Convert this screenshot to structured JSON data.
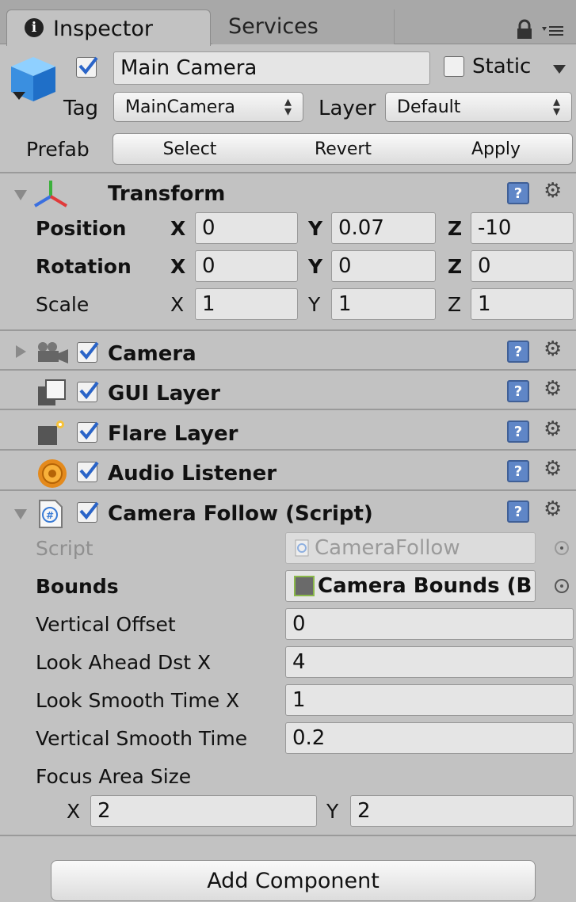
{
  "tabs": {
    "inspector": "Inspector",
    "services": "Services"
  },
  "header": {
    "active": true,
    "name": "Main Camera",
    "static_label": "Static",
    "static_checked": false,
    "tag_label": "Tag",
    "tag_value": "MainCamera",
    "layer_label": "Layer",
    "layer_value": "Default",
    "prefab_label": "Prefab",
    "prefab_buttons": [
      "Select",
      "Revert",
      "Apply"
    ]
  },
  "transform": {
    "title": "Transform",
    "rows": [
      {
        "label": "Position",
        "x": "0",
        "y": "0.07",
        "z": "-10"
      },
      {
        "label": "Rotation",
        "x": "0",
        "y": "0",
        "z": "0"
      },
      {
        "label": "Scale",
        "x": "1",
        "y": "1",
        "z": "1"
      }
    ],
    "axis": {
      "x": "X",
      "y": "Y",
      "z": "Z"
    }
  },
  "components": [
    {
      "title": "Camera",
      "enabled": true
    },
    {
      "title": "GUI Layer",
      "enabled": true
    },
    {
      "title": "Flare Layer",
      "enabled": true
    },
    {
      "title": "Audio Listener",
      "enabled": true
    }
  ],
  "script": {
    "title": "Camera Follow (Script)",
    "enabled": true,
    "script_label": "Script",
    "script_value": "CameraFollow",
    "bounds_label": "Bounds",
    "bounds_value": "Camera Bounds (B",
    "fields": [
      {
        "label": "Vertical Offset",
        "value": "0"
      },
      {
        "label": "Look Ahead Dst X",
        "value": "4"
      },
      {
        "label": "Look Smooth Time X",
        "value": "1"
      },
      {
        "label": "Vertical Smooth Time",
        "value": "0.2"
      }
    ],
    "focus_label": "Focus Area Size",
    "focus_x_label": "X",
    "focus_x": "2",
    "focus_y_label": "Y",
    "focus_y": "2"
  },
  "add_component_label": "Add Component",
  "colors": {
    "panel": "#c2c2c2",
    "tabbar": "#a8a8a8",
    "help_blue": "#5f86c7",
    "check_blue": "#2a64c8"
  }
}
